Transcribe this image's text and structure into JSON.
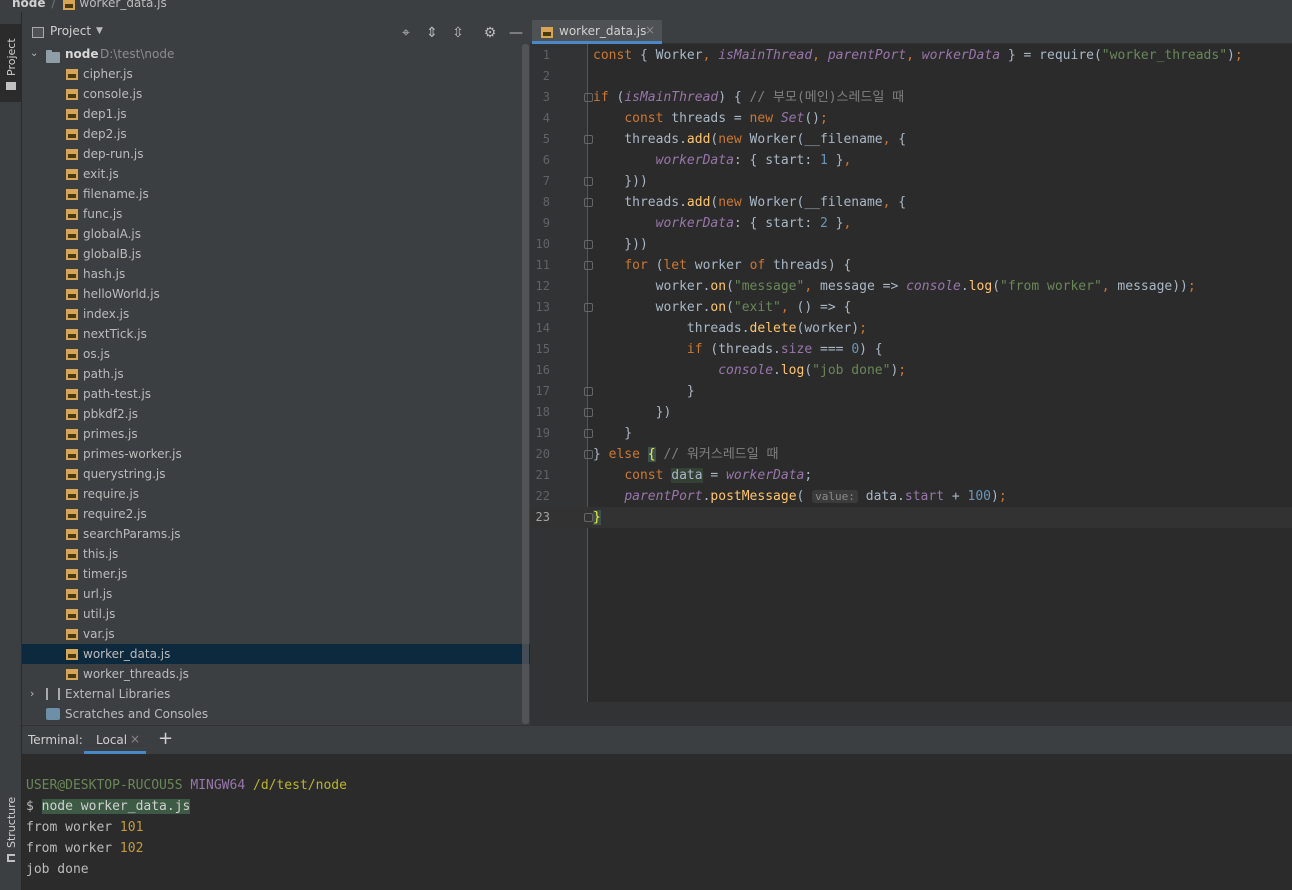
{
  "breadcrumb": {
    "root": "node",
    "file": "worker_data.js"
  },
  "left_strip": {
    "project_tab": "Project",
    "structure_tab": "Structure"
  },
  "project_panel": {
    "title": "Project",
    "root": {
      "name": "node",
      "path": "D:\\test\\node"
    },
    "files": [
      "cipher.js",
      "console.js",
      "dep1.js",
      "dep2.js",
      "dep-run.js",
      "exit.js",
      "filename.js",
      "func.js",
      "globalA.js",
      "globalB.js",
      "hash.js",
      "helloWorld.js",
      "index.js",
      "nextTick.js",
      "os.js",
      "path.js",
      "path-test.js",
      "pbkdf2.js",
      "primes.js",
      "primes-worker.js",
      "querystring.js",
      "require.js",
      "require2.js",
      "searchParams.js",
      "this.js",
      "timer.js",
      "url.js",
      "util.js",
      "var.js",
      "worker_data.js",
      "worker_threads.js"
    ],
    "selected_file": "worker_data.js",
    "external_libraries": "External Libraries",
    "scratches": "Scratches and Consoles"
  },
  "editor": {
    "tab_label": "worker_data.js",
    "current_line": 23,
    "lines": [
      "const { Worker, isMainThread, parentPort, workerData } = require(\"worker_threads\");",
      "",
      "if (isMainThread) { // 부모(메인)스레드일 때",
      "    const threads = new Set();",
      "    threads.add(new Worker(__filename, {",
      "        workerData: { start: 1 },",
      "    }))",
      "    threads.add(new Worker(__filename, {",
      "        workerData: { start: 2 },",
      "    }))",
      "    for (let worker of threads) {",
      "        worker.on(\"message\", message => console.log(\"from worker\", message));",
      "        worker.on(\"exit\", () => {",
      "            threads.delete(worker);",
      "            if (threads.size === 0) {",
      "                console.log(\"job done\");",
      "            }",
      "        })",
      "    }",
      "} else { // 워커스레드일 때",
      "    const data = workerData;",
      "    parentPort.postMessage( value: data.start + 100);",
      "}"
    ],
    "param_hint": "value:"
  },
  "terminal": {
    "label": "Terminal:",
    "tab": "Local",
    "prompt_user": "USER@DESKTOP-RUCOU5S",
    "prompt_env": "MINGW64",
    "prompt_path": "/d/test/node",
    "command_prefix": "$ ",
    "command": "node worker_data.js",
    "output": [
      {
        "text": "from worker ",
        "num": "101"
      },
      {
        "text": "from worker ",
        "num": "102"
      },
      {
        "text": "job done",
        "num": ""
      }
    ]
  },
  "colors": {
    "background": "#2b2b2b",
    "panel": "#3c3f41",
    "selection": "#0d293e",
    "keyword": "#cc7832",
    "string": "#6a8759",
    "number": "#6897bb",
    "property": "#9876aa",
    "function": "#ffc66d",
    "tab_accent": "#4a88c7"
  },
  "icons": [
    "js-file-icon",
    "folder-icon",
    "chevron-right-icon",
    "chevron-down-icon",
    "locate-icon",
    "expand-all-icon",
    "collapse-all-icon",
    "gear-icon",
    "minimize-icon",
    "close-icon",
    "add-icon",
    "library-icon",
    "scratches-icon"
  ]
}
